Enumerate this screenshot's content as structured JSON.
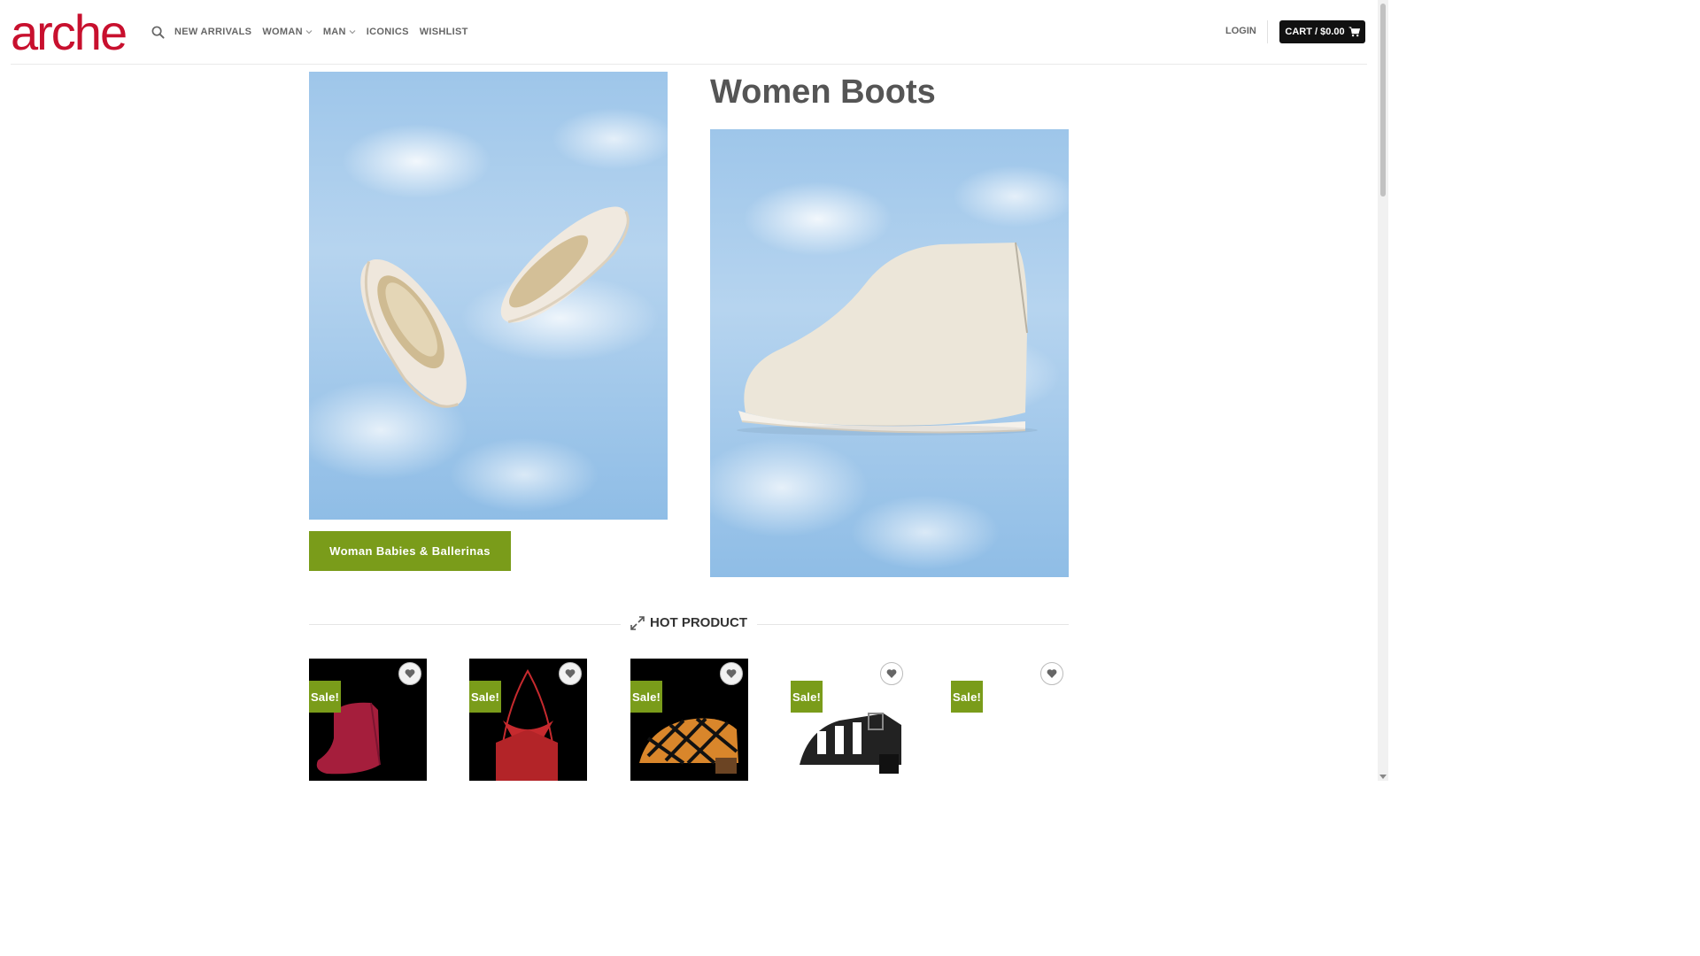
{
  "header": {
    "logo_text": "arche",
    "nav": [
      {
        "label": "NEW ARRIVALS",
        "has_dropdown": false
      },
      {
        "label": "WOMAN",
        "has_dropdown": true
      },
      {
        "label": "MAN",
        "has_dropdown": true
      },
      {
        "label": "ICONICS",
        "has_dropdown": false
      },
      {
        "label": "WISHLIST",
        "has_dropdown": false
      }
    ],
    "login_label": "LOGIN",
    "cart_label": "CART / $0.00"
  },
  "hero": {
    "ballerinas_button": "Woman Babies & Ballerinas",
    "page_title": "Women Boots"
  },
  "hot_product": {
    "title": "HOT PRODUCT"
  },
  "products": [
    {
      "badge": "Sale!",
      "image": "red-ankle-boot",
      "color": "#a51e3c"
    },
    {
      "badge": "Sale!",
      "image": "red-leather-bag",
      "color": "#c62a2e"
    },
    {
      "badge": "Sale!",
      "image": "orange-black-woven-sandal",
      "color": "#d9862b"
    },
    {
      "badge": "Sale!",
      "image": "black-strappy-sandal",
      "color": "#222222"
    },
    {
      "badge": "Sale!",
      "image": "",
      "color": ""
    }
  ],
  "colors": {
    "brand_red": "#c8102e",
    "accent_green": "#7a9c1a",
    "cart_bg": "#111111"
  }
}
